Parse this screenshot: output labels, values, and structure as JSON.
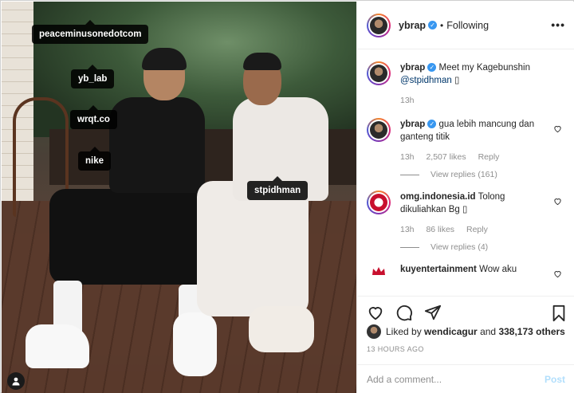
{
  "photo": {
    "tags": [
      "peaceminusonedotcom",
      "yb_lab",
      "wrqt.co",
      "nike",
      "stpidhman"
    ]
  },
  "header": {
    "username": "ybrap",
    "separator": "•",
    "follow_status": "Following",
    "more": "•••"
  },
  "comments": [
    {
      "username": "ybrap",
      "text": "Meet my Kagebunshin",
      "mention": "@stpidhman",
      "emoji": "▯",
      "time": "13h"
    },
    {
      "username": "ybrap",
      "text": "gua lebih mancung dan ganteng titik",
      "time": "13h",
      "likes": "2,507 likes",
      "reply": "Reply",
      "view_replies": "View replies (161)"
    },
    {
      "username": "omg.indonesia.id",
      "text": "Tolong dikuliahkan Bg ▯",
      "time": "13h",
      "likes": "86 likes",
      "reply": "Reply",
      "view_replies": "View replies (4)"
    },
    {
      "username": "kuyentertainment",
      "text": "Wow aku"
    }
  ],
  "likes": {
    "prefix": "Liked by",
    "user": "wendicagur",
    "connector": "and",
    "others": "338,173 others"
  },
  "timestamp": "13 HOURS AGO",
  "add_comment": {
    "placeholder": "Add a comment...",
    "post_label": "Post"
  },
  "colors": {
    "accent_blue": "#3897f0",
    "post_disabled": "#b2dffc",
    "secondary_text": "#8e8e8e"
  },
  "icons": [
    "more-icon",
    "heart-icon",
    "comment-icon",
    "share-icon",
    "bookmark-icon",
    "user-tag-icon",
    "verified-icon"
  ]
}
